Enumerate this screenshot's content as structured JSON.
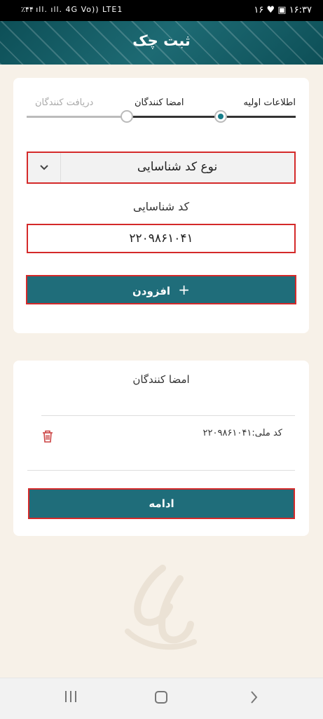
{
  "status_bar": {
    "left": "٪۴۴ ıll. ıll. 4G Vo)) LTE1",
    "right": "۱۶ ♥ ▣ ۱۶:۳۷"
  },
  "header": {
    "title": "ثبت چک"
  },
  "stepper": {
    "steps": [
      {
        "label": "اطلاعات اولیه",
        "state": "done"
      },
      {
        "label": "امضا کنندگان",
        "state": "active"
      },
      {
        "label": "دریافت کنندگان",
        "state": "pending"
      }
    ]
  },
  "form": {
    "id_type_select": {
      "value": "نوع کد شناسایی",
      "icon": "chevron-down-icon"
    },
    "id_label": "کد شناسایی",
    "id_value": "۲۲۰۹۸۶۱۰۴۱",
    "add_button": {
      "label": "افزودن",
      "icon": "plus-icon"
    }
  },
  "signers": {
    "title": "امضا کنندگان",
    "items": [
      {
        "text": "کد ملی:۲۲۰۹۸۶۱۰۴۱",
        "icon": "trash-icon"
      }
    ],
    "continue_button": "ادامه"
  },
  "colors": {
    "header_bg": "#0d4f57",
    "button_bg": "#1f6d7a",
    "highlight_border": "#d42a2a",
    "step_active": "#177d8a"
  },
  "navbar": {
    "icons": [
      "recent-apps-icon",
      "home-icon",
      "back-icon"
    ]
  }
}
